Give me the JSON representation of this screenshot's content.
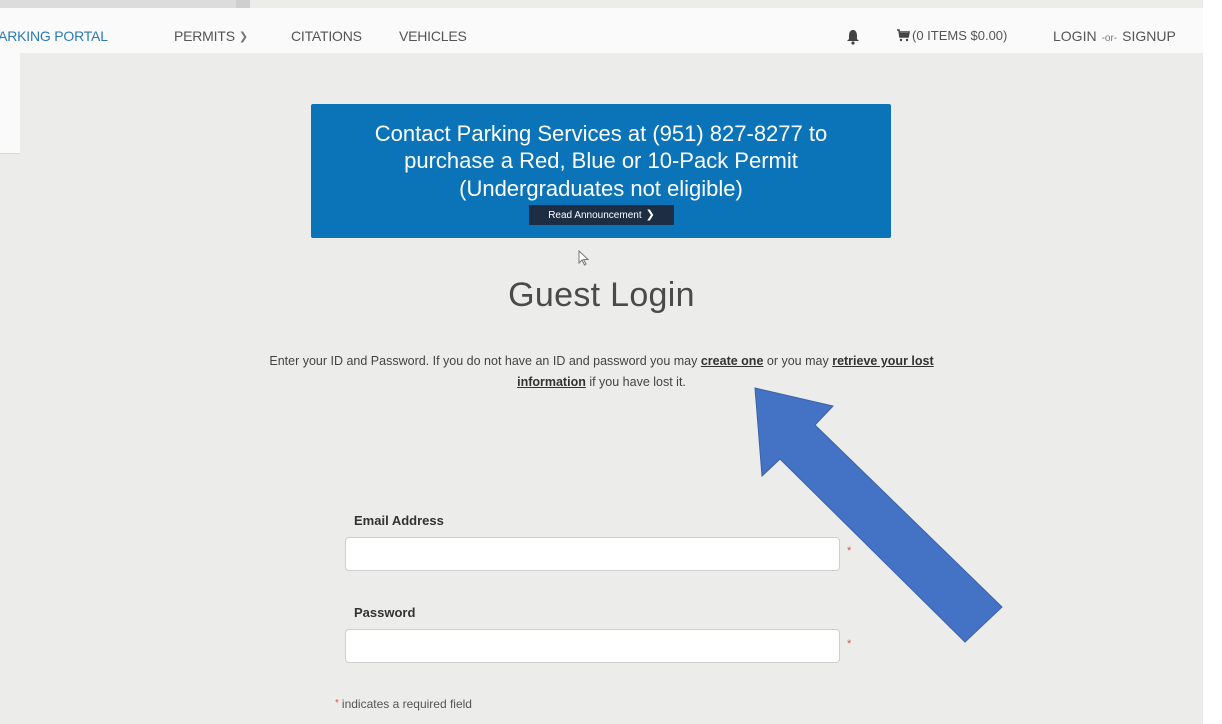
{
  "nav": {
    "brand": "PARKING PORTAL",
    "permits": "PERMITS",
    "citations": "CITATIONS",
    "vehicles": "VEHICLES",
    "cart": "(0 ITEMS $0.00)",
    "login": "LOGIN",
    "or": "-or-",
    "signup": "SIGNUP",
    "icons": [
      "bell-icon",
      "cart-icon",
      "chevron-down-icon"
    ]
  },
  "announcement": {
    "lines": [
      "Contact Parking Services at (951) 827-8277 to",
      "purchase a Red, Blue or 10-Pack Permit",
      "(Undergraduates not eligible)"
    ],
    "button": "Read Announcement",
    "color": "#0b73b8"
  },
  "login": {
    "title": "Guest Login",
    "intro_1a": "Enter your ID and Password. If you do not have an ID and password you may",
    "create_link": "create one",
    "intro_1b": "or you may",
    "retrieve_link_1": "retrieve your lost",
    "retrieve_link_2": "information",
    "intro_2b": "if you have lost it.",
    "email_label": "Email Address",
    "email_value": "",
    "password_label": "Password",
    "password_value": "",
    "required_mark": "*",
    "required_note": "indicates a required field"
  },
  "annotation": {
    "arrow_color": "#4472c4"
  }
}
